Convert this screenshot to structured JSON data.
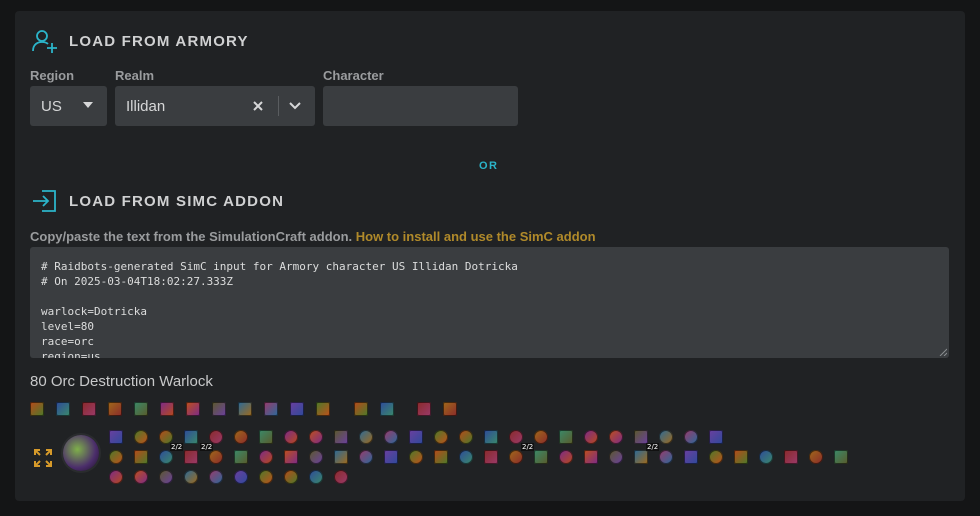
{
  "armory": {
    "title": "LOAD FROM ARMORY",
    "icon": "user-plus-icon"
  },
  "region": {
    "label": "Region",
    "value": "US",
    "icon": "caret-down-icon"
  },
  "realm": {
    "label": "Realm",
    "value": "Illidan",
    "clear_icon": "clear-icon",
    "dropdown_icon": "chevron-down-icon"
  },
  "character": {
    "label": "Character",
    "value": ""
  },
  "divider": {
    "or": "OR"
  },
  "simc": {
    "title": "LOAD FROM SIMC ADDON",
    "icon": "sign-in-icon",
    "instructions": "Copy/paste the text from the SimulationCraft addon. ",
    "link": "How to install and use the SimC addon",
    "lines": [
      "# Raidbots-generated SimC input for Armory character US Illidan Dotricka",
      "# On 2025-03-04T18:02:27.333Z",
      "",
      "warlock=Dotricka",
      "level=80",
      "race=orc",
      "region=us"
    ]
  },
  "character_summary": "80 Orc Destruction Warlock",
  "talent_tags": [
    "2/2",
    "2/2",
    "2/2",
    "2/2"
  ],
  "colors": {
    "accent": "#2bb4c9",
    "link": "#b08a2a",
    "panel": "#202224",
    "input": "#3a3d40"
  }
}
